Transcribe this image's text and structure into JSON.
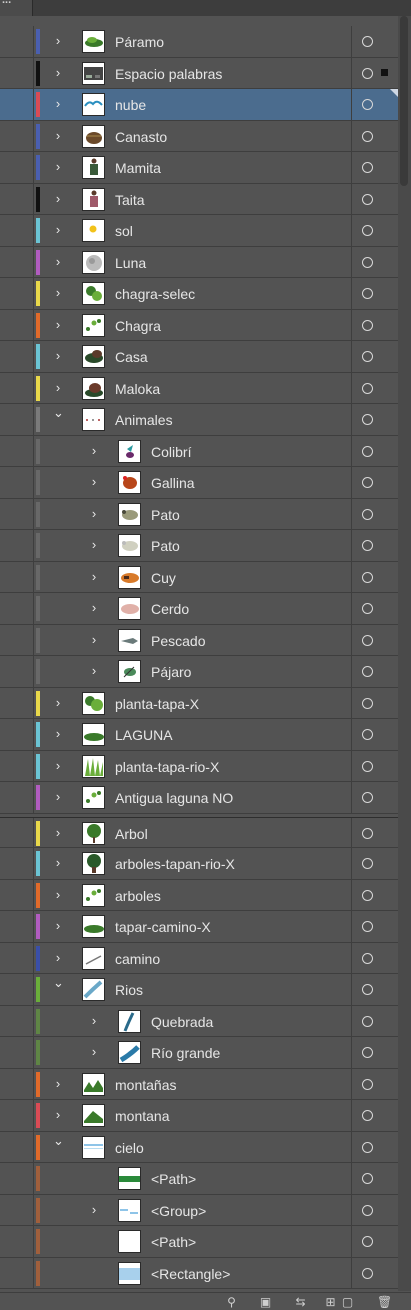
{
  "panel": {
    "tab_label": "..."
  },
  "colors": {
    "bg": "#535353",
    "selected": "#4b6c8e"
  },
  "layers": [
    {
      "name": "Páramo",
      "level": 0,
      "expand": "collapsed",
      "color": "#4a5fb0",
      "thumb": "paramo"
    },
    {
      "name": "Espacio palabras",
      "level": 0,
      "expand": "collapsed",
      "color": "#111111",
      "thumb": "espacio",
      "selected_art": true
    },
    {
      "name": "nube",
      "level": 0,
      "expand": "collapsed",
      "color": "#d94b55",
      "thumb": "nube",
      "selected": true
    },
    {
      "name": "Canasto",
      "level": 0,
      "expand": "collapsed",
      "color": "#4a5fb0",
      "thumb": "canasto"
    },
    {
      "name": "Mamita",
      "level": 0,
      "expand": "collapsed",
      "color": "#4a5fb0",
      "thumb": "mamita"
    },
    {
      "name": "Taita",
      "level": 0,
      "expand": "collapsed",
      "color": "#111111",
      "thumb": "taita"
    },
    {
      "name": "sol",
      "level": 0,
      "expand": "collapsed",
      "color": "#6bc4d4",
      "thumb": "sol"
    },
    {
      "name": "Luna",
      "level": 0,
      "expand": "collapsed",
      "color": "#b15cc0",
      "thumb": "luna"
    },
    {
      "name": "chagra-selec",
      "level": 0,
      "expand": "collapsed",
      "color": "#e8d84a",
      "thumb": "green"
    },
    {
      "name": "Chagra",
      "level": 0,
      "expand": "collapsed",
      "color": "#e06a2a",
      "thumb": "green-dots"
    },
    {
      "name": "Casa",
      "level": 0,
      "expand": "collapsed",
      "color": "#6bc4d4",
      "thumb": "casa"
    },
    {
      "name": "Maloka",
      "level": 0,
      "expand": "collapsed",
      "color": "#e8d84a",
      "thumb": "maloka"
    },
    {
      "name": "Animales",
      "level": 0,
      "expand": "expanded",
      "color": "#7a7a7a",
      "thumb": "dots"
    },
    {
      "name": "Colibrí",
      "level": 1,
      "expand": "collapsed",
      "color": "#7a7a7a",
      "thumb": "colibri"
    },
    {
      "name": "Gallina",
      "level": 1,
      "expand": "collapsed",
      "color": "#7a7a7a",
      "thumb": "gallina"
    },
    {
      "name": "Pato",
      "level": 1,
      "expand": "collapsed",
      "color": "#7a7a7a",
      "thumb": "pato"
    },
    {
      "name": "Pato",
      "level": 1,
      "expand": "collapsed",
      "color": "#7a7a7a",
      "thumb": "pato2"
    },
    {
      "name": "Cuy",
      "level": 1,
      "expand": "collapsed",
      "color": "#7a7a7a",
      "thumb": "cuy"
    },
    {
      "name": "Cerdo",
      "level": 1,
      "expand": "collapsed",
      "color": "#7a7a7a",
      "thumb": "cerdo"
    },
    {
      "name": "Pescado",
      "level": 1,
      "expand": "collapsed",
      "color": "#7a7a7a",
      "thumb": "pescado"
    },
    {
      "name": "Pájaro",
      "level": 1,
      "expand": "collapsed",
      "color": "#7a7a7a",
      "thumb": "pajaro"
    },
    {
      "name": "planta-tapa-X",
      "level": 0,
      "expand": "collapsed",
      "color": "#e8d84a",
      "thumb": "planta"
    },
    {
      "name": "LAGUNA",
      "level": 0,
      "expand": "collapsed",
      "color": "#6bc4d4",
      "thumb": "laguna"
    },
    {
      "name": "planta-tapa-rio-X",
      "level": 0,
      "expand": "collapsed",
      "color": "#6bc4d4",
      "thumb": "grass"
    },
    {
      "name": "Antigua laguna NO",
      "level": 0,
      "expand": "collapsed",
      "color": "#b15cc0",
      "thumb": "green-dots"
    },
    {
      "name": "Arbol",
      "level": 0,
      "expand": "collapsed",
      "color": "#e8d84a",
      "thumb": "arbol",
      "gap": true
    },
    {
      "name": "arboles-tapan-rio-X",
      "level": 0,
      "expand": "collapsed",
      "color": "#6bc4d4",
      "thumb": "arbol2"
    },
    {
      "name": "arboles",
      "level": 0,
      "expand": "collapsed",
      "color": "#e06a2a",
      "thumb": "green-dots"
    },
    {
      "name": "tapar-camino-X",
      "level": 0,
      "expand": "collapsed",
      "color": "#b15cc0",
      "thumb": "laguna"
    },
    {
      "name": "camino",
      "level": 0,
      "expand": "collapsed",
      "color": "#3a4fa8",
      "thumb": "camino"
    },
    {
      "name": "Rios",
      "level": 0,
      "expand": "expanded",
      "color": "#6aae3a",
      "thumb": "rios"
    },
    {
      "name": "Quebrada",
      "level": 1,
      "expand": "collapsed",
      "color": "#6aae3a",
      "thumb": "quebrada"
    },
    {
      "name": "Río grande",
      "level": 1,
      "expand": "collapsed",
      "color": "#6aae3a",
      "thumb": "riogrande"
    },
    {
      "name": "montañas",
      "level": 0,
      "expand": "collapsed",
      "color": "#e06a2a",
      "thumb": "montanas"
    },
    {
      "name": "montana",
      "level": 0,
      "expand": "collapsed",
      "color": "#d94b55",
      "thumb": "montana"
    },
    {
      "name": "cielo",
      "level": 0,
      "expand": "expanded",
      "color": "#e06a2a",
      "thumb": "cielo"
    },
    {
      "name": "<Path>",
      "level": 1,
      "expand": "none",
      "color": "#e06a2a",
      "thumb": "path-green"
    },
    {
      "name": "<Group>",
      "level": 1,
      "expand": "collapsed",
      "color": "#e06a2a",
      "thumb": "group"
    },
    {
      "name": "<Path>",
      "level": 1,
      "expand": "none",
      "color": "#e06a2a",
      "thumb": "blank"
    },
    {
      "name": "<Rectangle>",
      "level": 1,
      "expand": "none",
      "color": "#e06a2a",
      "thumb": "rect"
    }
  ],
  "bottom_toolbar": [
    {
      "icon": "search-icon",
      "glyph": "⚲"
    },
    {
      "icon": "collect-export-icon",
      "glyph": "▣"
    },
    {
      "icon": "clipping-mask-icon",
      "glyph": "⇆"
    },
    {
      "icon": "new-sublayer-icon",
      "glyph": "⊞"
    },
    {
      "icon": "new-layer-icon",
      "glyph": "▢"
    },
    {
      "icon": "delete-icon",
      "glyph": "🗑"
    }
  ]
}
